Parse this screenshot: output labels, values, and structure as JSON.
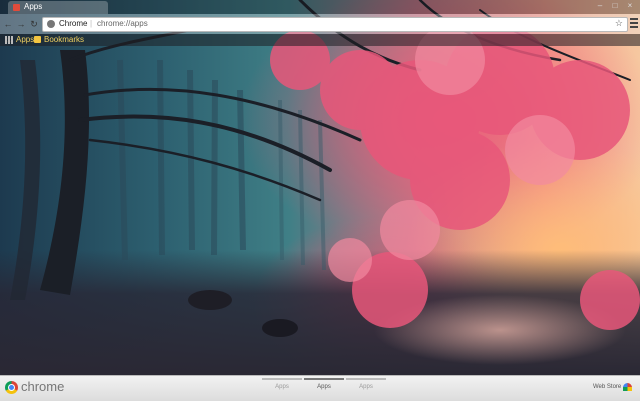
{
  "tab": {
    "title": "Apps",
    "icon": "apps-favicon-icon"
  },
  "window_controls": [
    "–",
    "□",
    "×"
  ],
  "toolbar": {
    "back": "←",
    "forward": "→",
    "reload": "↻"
  },
  "omnibox": {
    "scheme_label": "Chrome",
    "separator": "|",
    "url": "chrome://apps",
    "star": "☆"
  },
  "bookmarks": {
    "apps_label": "Apps",
    "bookmarks_label": "Bookmarks"
  },
  "bottom": {
    "brand": "chrome",
    "pages": [
      {
        "label": "Apps"
      },
      {
        "label": "Apps"
      },
      {
        "label": "Apps"
      }
    ],
    "active_page": 1,
    "webstore_label": "Web Store"
  },
  "colors": {
    "accent_bookmark": "#f0d060",
    "forest_pink": "#e8577a",
    "forest_teal": "#3f7f86"
  }
}
